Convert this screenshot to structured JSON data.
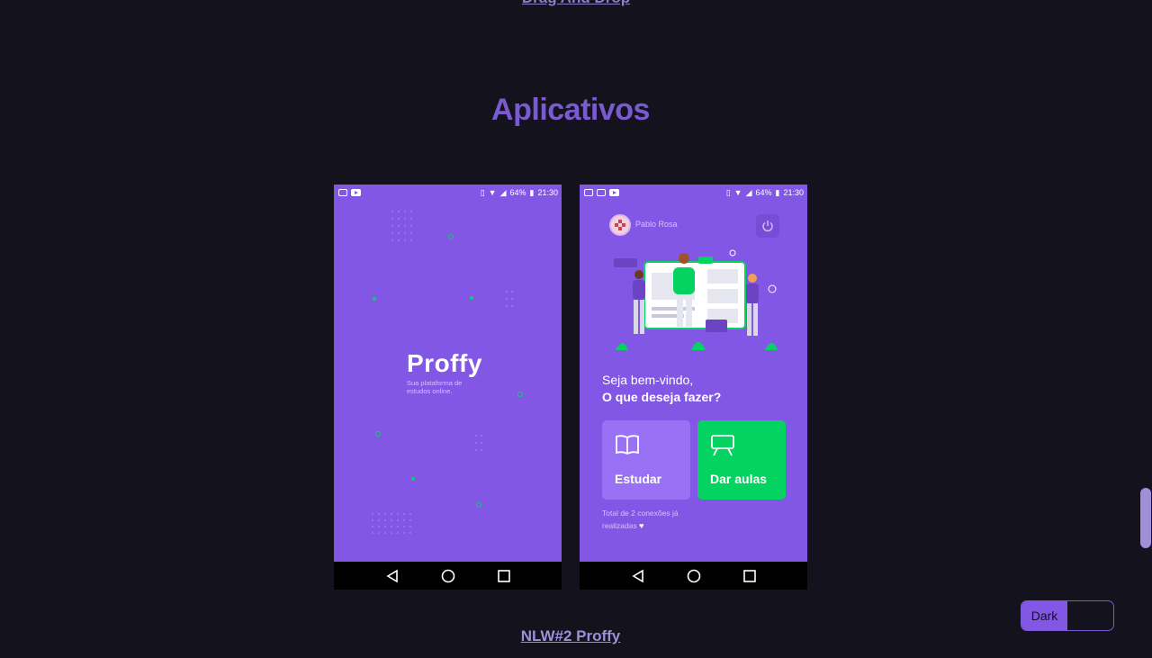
{
  "top_link": "Drag And Drop",
  "section_title": "Aplicativos",
  "phones": {
    "status": {
      "battery": "64%",
      "time": "21:30"
    },
    "splash": {
      "logo": "Proffy",
      "tagline": "Sua plataforma de estudos online."
    },
    "landing": {
      "user_name": "Pablo Rosa",
      "welcome_line1": "Seja bem-vindo,",
      "welcome_line2": "O que deseja fazer?",
      "study_label": "Estudar",
      "teach_label": "Dar aulas",
      "total_text": "Total de 2 conexões já realizadas",
      "study_color": "#9871f5",
      "teach_color": "#04d361"
    },
    "background_color": "#8257e5"
  },
  "project_link": "NLW#2 Proffy",
  "theme_toggle": {
    "label": "Dark"
  },
  "colors": {
    "page_bg": "#13121d",
    "accent": "#7a5ad0"
  }
}
